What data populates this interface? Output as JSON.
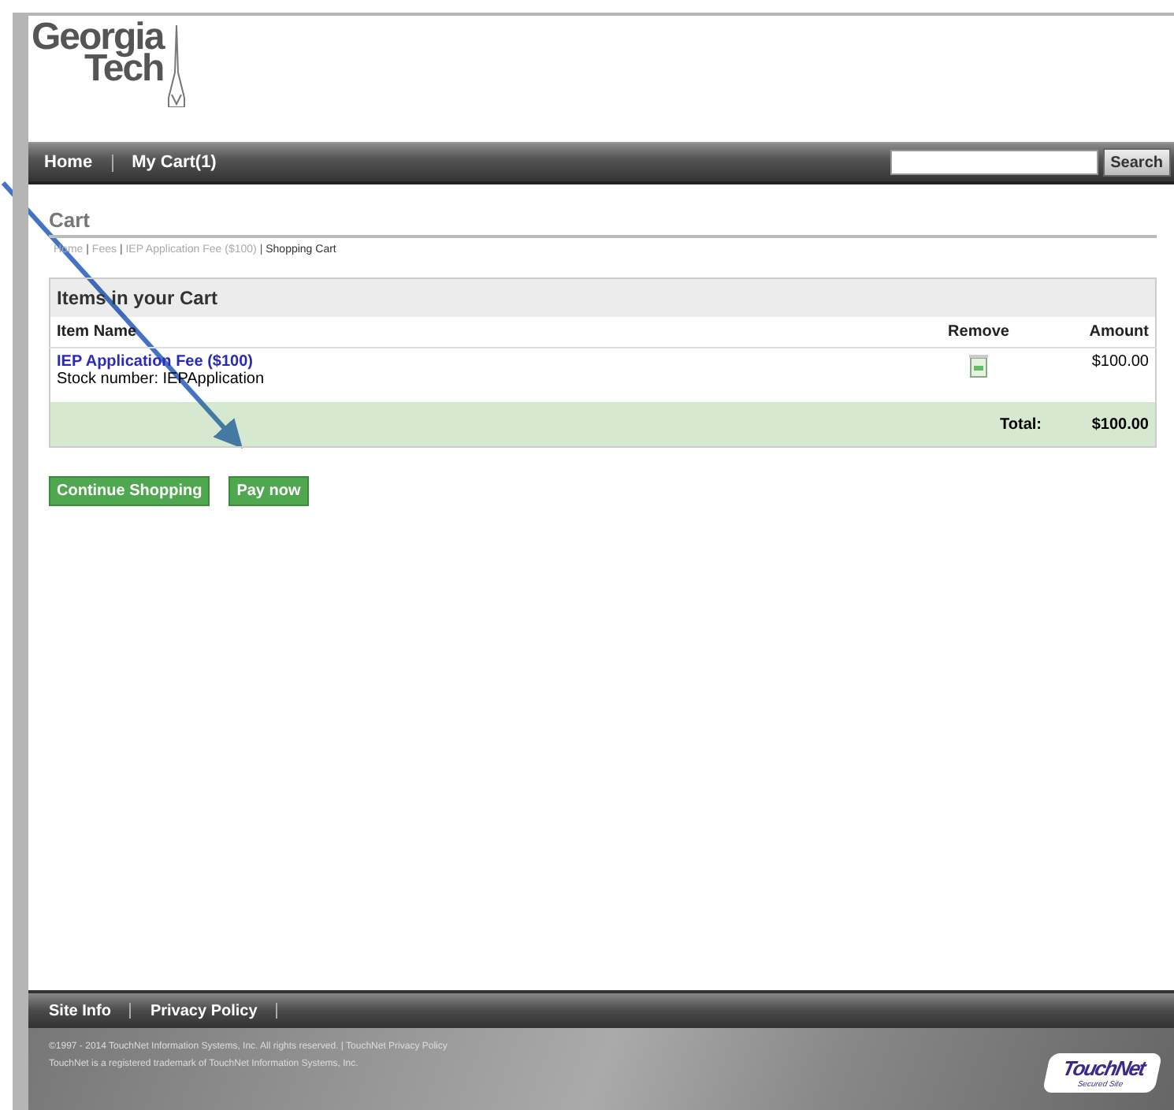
{
  "logo": {
    "line_1": "Georgia",
    "line_2": "Tech"
  },
  "nav": {
    "links": [
      "Home",
      "My Cart(1)"
    ],
    "search_button": "Search"
  },
  "page_title": "Cart",
  "breadcrumb_separator": "|",
  "breadcrumb": [
    {
      "label": "Home",
      "current": false
    },
    {
      "label": "Fees",
      "current": false
    },
    {
      "label": "IEP Application Fee ($100)",
      "current": false
    },
    {
      "label": "Shopping Cart",
      "current": true
    }
  ],
  "cart": {
    "heading": "Items in your Cart",
    "columns": [
      "Item Name",
      "Remove",
      "Amount"
    ],
    "items": [
      {
        "name": "IEP Application Fee ($100)",
        "stock": "Stock number: IEPApplication",
        "amount": "$100.00"
      }
    ],
    "total_label": "Total:",
    "total": "$100.00"
  },
  "buttons": [
    "Continue Shopping",
    "Pay now"
  ],
  "footer": {
    "links": [
      "Site Info",
      "Privacy Policy"
    ],
    "copyright": "©1997 - 2014 TouchNet Information Systems, Inc. All rights reserved. | TouchNet Privacy Policy",
    "trademark": "TouchNet is a registered trademark of TouchNet Information Systems, Inc.",
    "badge_name": "TouchNet",
    "badge_sub": "Secured Site"
  }
}
